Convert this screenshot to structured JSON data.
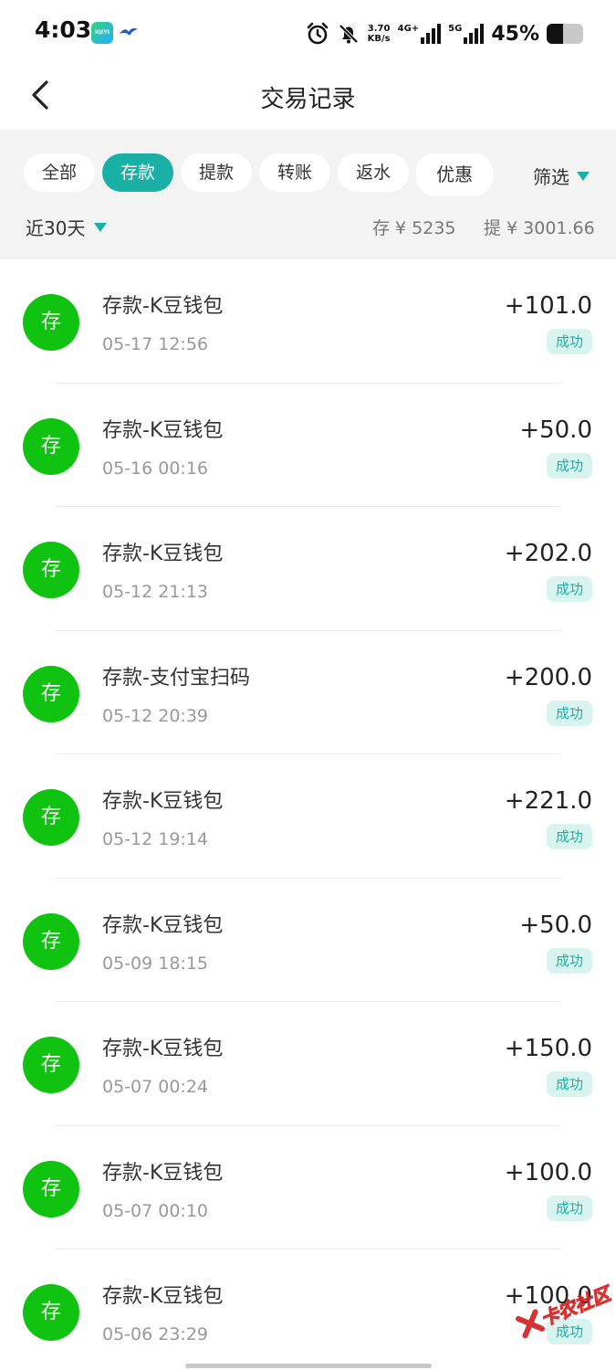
{
  "status_bar": {
    "time": "4:03",
    "app_icon_text": "iQIYI",
    "speed_value": "3.70",
    "speed_unit": "KB/s",
    "net1": "4G+",
    "net2": "5G",
    "battery_text": "45%",
    "battery_level": 0.45
  },
  "header": {
    "title": "交易记录"
  },
  "filters": {
    "chips": [
      {
        "label": "全部",
        "active": false
      },
      {
        "label": "存款",
        "active": true
      },
      {
        "label": "提款",
        "active": false
      },
      {
        "label": "转账",
        "active": false
      },
      {
        "label": "返水",
        "active": false
      },
      {
        "label": "优惠",
        "active": false
      }
    ],
    "screen_label": "筛选",
    "range_label": "近30天",
    "deposit_total": "存 ¥ 5235",
    "withdraw_total": "提 ¥ 3001.66"
  },
  "transactions": [
    {
      "icon_text": "存",
      "name": "存款-K豆钱包",
      "time": "05-17 12:56",
      "amount": "+101.0",
      "status": "成功"
    },
    {
      "icon_text": "存",
      "name": "存款-K豆钱包",
      "time": "05-16 00:16",
      "amount": "+50.0",
      "status": "成功"
    },
    {
      "icon_text": "存",
      "name": "存款-K豆钱包",
      "time": "05-12 21:13",
      "amount": "+202.0",
      "status": "成功"
    },
    {
      "icon_text": "存",
      "name": "存款-支付宝扫码",
      "time": "05-12 20:39",
      "amount": "+200.0",
      "status": "成功"
    },
    {
      "icon_text": "存",
      "name": "存款-K豆钱包",
      "time": "05-12 19:14",
      "amount": "+221.0",
      "status": "成功"
    },
    {
      "icon_text": "存",
      "name": "存款-K豆钱包",
      "time": "05-09 18:15",
      "amount": "+50.0",
      "status": "成功"
    },
    {
      "icon_text": "存",
      "name": "存款-K豆钱包",
      "time": "05-07 00:24",
      "amount": "+150.0",
      "status": "成功"
    },
    {
      "icon_text": "存",
      "name": "存款-K豆钱包",
      "time": "05-07 00:10",
      "amount": "+100.0",
      "status": "成功"
    },
    {
      "icon_text": "存",
      "name": "存款-K豆钱包",
      "time": "05-06 23:29",
      "amount": "+100.0",
      "status": "成功"
    }
  ],
  "watermark": {
    "text": "卡农社区"
  },
  "colors": {
    "accent": "#19b1a6",
    "deposit_icon": "#11c311",
    "status_bg": "#d9f3ef",
    "panel_bg": "#f3f3f3"
  }
}
